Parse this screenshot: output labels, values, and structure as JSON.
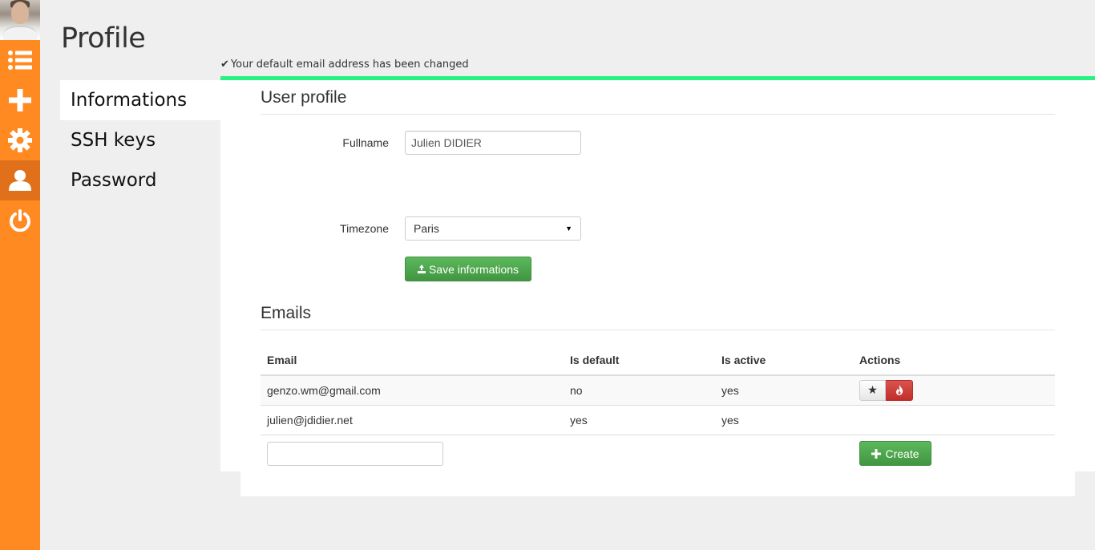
{
  "page": {
    "title": "Profile"
  },
  "flash": {
    "icon": "check-icon",
    "message": "Your default email address has been changed"
  },
  "rail": {
    "items": [
      {
        "icon": "list-icon"
      },
      {
        "icon": "plus-icon"
      },
      {
        "icon": "gear-icon"
      },
      {
        "icon": "user-icon",
        "active": true
      },
      {
        "icon": "power-icon"
      }
    ]
  },
  "subnav": {
    "items": [
      {
        "label": "Informations",
        "active": true
      },
      {
        "label": "SSH keys"
      },
      {
        "label": "Password"
      }
    ]
  },
  "user_profile": {
    "title": "User profile",
    "fullname_label": "Fullname",
    "fullname_value": "Julien DIDIER",
    "timezone_label": "Timezone",
    "timezone_value": "Paris",
    "save_label": "Save informations"
  },
  "emails": {
    "title": "Emails",
    "columns": [
      "Email",
      "Is default",
      "Is active",
      "Actions"
    ],
    "rows": [
      {
        "email": "genzo.wm@gmail.com",
        "is_default": "no",
        "is_active": "yes",
        "has_actions": true
      },
      {
        "email": "julien@jdidier.net",
        "is_default": "yes",
        "is_active": "yes",
        "has_actions": false
      }
    ],
    "new_email_value": "",
    "create_label": "Create"
  },
  "colors": {
    "rail": "#ff8a22",
    "rail_active": "#e0701a",
    "flash_bar": "#2af282",
    "button_green": "#5cb85c",
    "button_red": "#d9534f"
  }
}
